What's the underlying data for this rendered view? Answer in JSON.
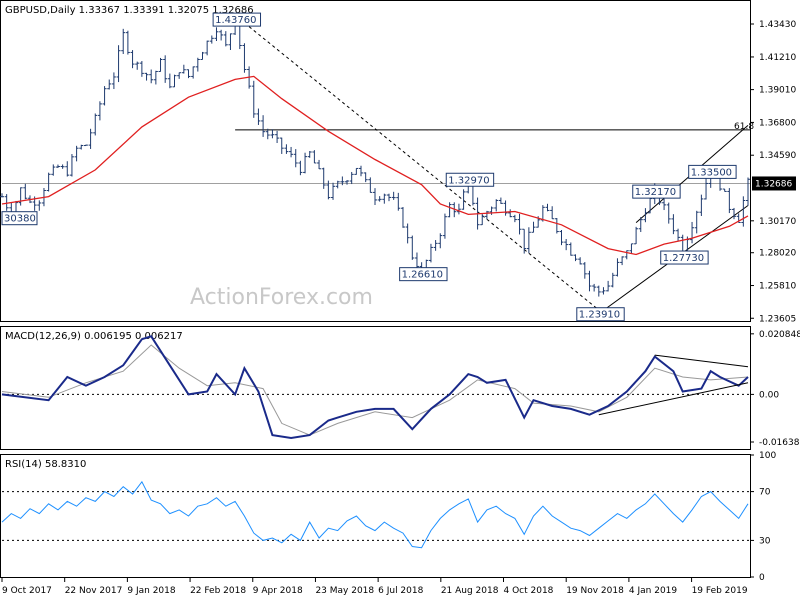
{
  "chart_data": [
    {
      "type": "candlestick",
      "panel": "price",
      "title": "GBPUSD,Daily  1.33367 1.33391 1.32075 1.32686",
      "symbol": "GBPUSD",
      "timeframe": "Daily",
      "ohlc": {
        "open": "1.33367",
        "high": "1.33391",
        "low": "1.32075",
        "close": "1.32686"
      },
      "current_price": "1.32686",
      "y_ticks": [
        "1.43430",
        "1.41210",
        "1.39010",
        "1.36800",
        "1.34590",
        "1.30170",
        "1.28020",
        "1.25810",
        "1.23605"
      ],
      "ylim": [
        1.2342,
        1.4498
      ],
      "x_ticks": [
        "9 Oct 2017",
        "22 Nov 2017",
        "9 Jan 2018",
        "22 Feb 2018",
        "9 Apr 2018",
        "23 May 2018",
        "6 Jul 2018",
        "21 Aug 2018",
        "4 Oct 2018",
        "19 Nov 2018",
        "4 Jan 2019",
        "19 Feb 2019"
      ],
      "close_path": [
        [
          0,
          1.318
        ],
        [
          2,
          1.306
        ],
        [
          4,
          1.323
        ],
        [
          6,
          1.314
        ],
        [
          8,
          1.316
        ],
        [
          10,
          1.332
        ],
        [
          12,
          1.338
        ],
        [
          14,
          1.335
        ],
        [
          16,
          1.35
        ],
        [
          18,
          1.353
        ],
        [
          20,
          1.37
        ],
        [
          22,
          1.391
        ],
        [
          24,
          1.4
        ],
        [
          26,
          1.427
        ],
        [
          28,
          1.409
        ],
        [
          30,
          1.404
        ],
        [
          32,
          1.397
        ],
        [
          34,
          1.408
        ],
        [
          36,
          1.391
        ],
        [
          38,
          1.404
        ],
        [
          40,
          1.399
        ],
        [
          42,
          1.412
        ],
        [
          44,
          1.422
        ],
        [
          46,
          1.432
        ],
        [
          48,
          1.419
        ],
        [
          50,
          1.438
        ],
        [
          52,
          1.404
        ],
        [
          54,
          1.376
        ],
        [
          56,
          1.362
        ],
        [
          58,
          1.358
        ],
        [
          60,
          1.351
        ],
        [
          62,
          1.345
        ],
        [
          64,
          1.337
        ],
        [
          66,
          1.347
        ],
        [
          68,
          1.334
        ],
        [
          70,
          1.319
        ],
        [
          72,
          1.326
        ],
        [
          74,
          1.331
        ],
        [
          76,
          1.338
        ],
        [
          78,
          1.327
        ],
        [
          80,
          1.318
        ],
        [
          82,
          1.32
        ],
        [
          84,
          1.315
        ],
        [
          86,
          1.3
        ],
        [
          88,
          1.278
        ],
        [
          90,
          1.268
        ],
        [
          92,
          1.281
        ],
        [
          94,
          1.294
        ],
        [
          96,
          1.312
        ],
        [
          98,
          1.308
        ],
        [
          100,
          1.33
        ],
        [
          102,
          1.3
        ],
        [
          104,
          1.308
        ],
        [
          106,
          1.315
        ],
        [
          108,
          1.31
        ],
        [
          110,
          1.305
        ],
        [
          112,
          1.285
        ],
        [
          114,
          1.297
        ],
        [
          116,
          1.31
        ],
        [
          118,
          1.302
        ],
        [
          120,
          1.29
        ],
        [
          122,
          1.281
        ],
        [
          124,
          1.275
        ],
        [
          126,
          1.258
        ],
        [
          128,
          1.254
        ],
        [
          130,
          1.258
        ],
        [
          132,
          1.272
        ],
        [
          134,
          1.28
        ],
        [
          136,
          1.295
        ],
        [
          138,
          1.31
        ],
        [
          140,
          1.321
        ],
        [
          142,
          1.31
        ],
        [
          144,
          1.297
        ],
        [
          146,
          1.283
        ],
        [
          148,
          1.3
        ],
        [
          150,
          1.318
        ],
        [
          152,
          1.337
        ],
        [
          154,
          1.326
        ],
        [
          156,
          1.311
        ],
        [
          158,
          1.303
        ],
        [
          160,
          1.327
        ]
      ],
      "moving_average": [
        [
          0,
          1.313
        ],
        [
          10,
          1.318
        ],
        [
          20,
          1.336
        ],
        [
          30,
          1.365
        ],
        [
          40,
          1.385
        ],
        [
          50,
          1.397
        ],
        [
          54,
          1.399
        ],
        [
          60,
          1.384
        ],
        [
          70,
          1.362
        ],
        [
          80,
          1.343
        ],
        [
          90,
          1.326
        ],
        [
          94,
          1.313
        ],
        [
          100,
          1.306
        ],
        [
          110,
          1.308
        ],
        [
          120,
          1.299
        ],
        [
          130,
          1.283
        ],
        [
          136,
          1.279
        ],
        [
          142,
          1.286
        ],
        [
          148,
          1.29
        ],
        [
          152,
          1.294
        ],
        [
          156,
          1.298
        ],
        [
          160,
          1.305
        ]
      ],
      "labels": [
        {
          "text": "1.43760",
          "x": 50,
          "y": 1.4376
        },
        {
          "text": "1.32970",
          "x": 100,
          "y": 1.3297
        },
        {
          "text": "1.26610",
          "x": 90,
          "y": 1.2661
        },
        {
          "text": "1.23910",
          "x": 128,
          "y": 1.2391
        },
        {
          "text": "1.32170",
          "x": 140,
          "y": 1.3217
        },
        {
          "text": "1.33500",
          "x": 152,
          "y": 1.335
        },
        {
          "text": "1.27730",
          "x": 146,
          "y": 1.2773
        },
        {
          "text": "30380",
          "x": 2,
          "y": 1.3038
        }
      ],
      "fib_label": "61.8",
      "fib_level": 1.363,
      "watermark": "ActionForex.com"
    },
    {
      "type": "line",
      "panel": "macd",
      "title": "MACD(12,26,9) 0.006195 0.006217",
      "y_ticks": [
        "0.020848",
        "0.00",
        "-0.016389"
      ],
      "ylim": [
        -0.0188,
        0.0232
      ],
      "macd": [
        [
          0,
          0.0
        ],
        [
          10,
          -0.002
        ],
        [
          14,
          0.006
        ],
        [
          18,
          0.003
        ],
        [
          22,
          0.006
        ],
        [
          26,
          0.01
        ],
        [
          30,
          0.019
        ],
        [
          32,
          0.02
        ],
        [
          36,
          0.01
        ],
        [
          40,
          0.0
        ],
        [
          44,
          0.001
        ],
        [
          46,
          0.007
        ],
        [
          50,
          0.0
        ],
        [
          52,
          0.009
        ],
        [
          55,
          0.001
        ],
        [
          58,
          -0.014
        ],
        [
          62,
          -0.015
        ],
        [
          66,
          -0.014
        ],
        [
          70,
          -0.009
        ],
        [
          72,
          -0.008
        ],
        [
          76,
          -0.006
        ],
        [
          80,
          -0.005
        ],
        [
          84,
          -0.005
        ],
        [
          88,
          -0.012
        ],
        [
          92,
          -0.005
        ],
        [
          96,
          0.0
        ],
        [
          100,
          0.007
        ],
        [
          102,
          0.006
        ],
        [
          104,
          0.004
        ],
        [
          108,
          0.005
        ],
        [
          112,
          -0.008
        ],
        [
          114,
          -0.002
        ],
        [
          118,
          -0.004
        ],
        [
          122,
          -0.005
        ],
        [
          126,
          -0.007
        ],
        [
          130,
          -0.004
        ],
        [
          134,
          0.001
        ],
        [
          138,
          0.008
        ],
        [
          140,
          0.013
        ],
        [
          144,
          0.008
        ],
        [
          146,
          0.001
        ],
        [
          150,
          0.002
        ],
        [
          152,
          0.008
        ],
        [
          154,
          0.006
        ],
        [
          158,
          0.003
        ],
        [
          160,
          0.006
        ]
      ],
      "signal": [
        [
          0,
          0.001
        ],
        [
          10,
          -0.001
        ],
        [
          18,
          0.004
        ],
        [
          26,
          0.008
        ],
        [
          32,
          0.017
        ],
        [
          38,
          0.009
        ],
        [
          44,
          0.003
        ],
        [
          50,
          0.004
        ],
        [
          56,
          0.002
        ],
        [
          60,
          -0.01
        ],
        [
          66,
          -0.014
        ],
        [
          72,
          -0.01
        ],
        [
          80,
          -0.006
        ],
        [
          88,
          -0.008
        ],
        [
          96,
          -0.002
        ],
        [
          102,
          0.005
        ],
        [
          110,
          0.002
        ],
        [
          114,
          -0.003
        ],
        [
          122,
          -0.004
        ],
        [
          128,
          -0.006
        ],
        [
          134,
          -0.001
        ],
        [
          140,
          0.009
        ],
        [
          146,
          0.006
        ],
        [
          152,
          0.005
        ],
        [
          160,
          0.006
        ]
      ]
    },
    {
      "type": "line",
      "panel": "rsi",
      "title": "RSI(14) 58.8310",
      "y_ticks": [
        "100",
        "70",
        "30",
        "0"
      ],
      "ylim": [
        0,
        100
      ],
      "rsi": [
        [
          0,
          45
        ],
        [
          2,
          52
        ],
        [
          4,
          48
        ],
        [
          6,
          56
        ],
        [
          8,
          52
        ],
        [
          10,
          60
        ],
        [
          12,
          55
        ],
        [
          14,
          62
        ],
        [
          16,
          58
        ],
        [
          18,
          65
        ],
        [
          20,
          62
        ],
        [
          22,
          70
        ],
        [
          24,
          66
        ],
        [
          26,
          74
        ],
        [
          28,
          68
        ],
        [
          30,
          78
        ],
        [
          32,
          63
        ],
        [
          34,
          60
        ],
        [
          36,
          52
        ],
        [
          38,
          55
        ],
        [
          40,
          50
        ],
        [
          42,
          58
        ],
        [
          44,
          60
        ],
        [
          46,
          65
        ],
        [
          48,
          58
        ],
        [
          50,
          62
        ],
        [
          52,
          50
        ],
        [
          54,
          36
        ],
        [
          56,
          30
        ],
        [
          58,
          32
        ],
        [
          60,
          28
        ],
        [
          62,
          35
        ],
        [
          64,
          30
        ],
        [
          66,
          45
        ],
        [
          68,
          32
        ],
        [
          70,
          40
        ],
        [
          72,
          38
        ],
        [
          74,
          46
        ],
        [
          76,
          50
        ],
        [
          78,
          42
        ],
        [
          80,
          38
        ],
        [
          82,
          45
        ],
        [
          84,
          40
        ],
        [
          86,
          36
        ],
        [
          88,
          25
        ],
        [
          90,
          24
        ],
        [
          92,
          38
        ],
        [
          94,
          48
        ],
        [
          96,
          55
        ],
        [
          98,
          60
        ],
        [
          100,
          64
        ],
        [
          102,
          45
        ],
        [
          104,
          55
        ],
        [
          106,
          58
        ],
        [
          108,
          52
        ],
        [
          110,
          48
        ],
        [
          112,
          35
        ],
        [
          114,
          50
        ],
        [
          116,
          58
        ],
        [
          118,
          50
        ],
        [
          120,
          45
        ],
        [
          122,
          40
        ],
        [
          124,
          38
        ],
        [
          126,
          34
        ],
        [
          128,
          40
        ],
        [
          130,
          46
        ],
        [
          132,
          52
        ],
        [
          134,
          48
        ],
        [
          136,
          55
        ],
        [
          138,
          60
        ],
        [
          140,
          68
        ],
        [
          142,
          60
        ],
        [
          144,
          52
        ],
        [
          146,
          45
        ],
        [
          148,
          55
        ],
        [
          150,
          66
        ],
        [
          152,
          70
        ],
        [
          154,
          62
        ],
        [
          156,
          55
        ],
        [
          158,
          48
        ],
        [
          160,
          60
        ]
      ]
    }
  ]
}
